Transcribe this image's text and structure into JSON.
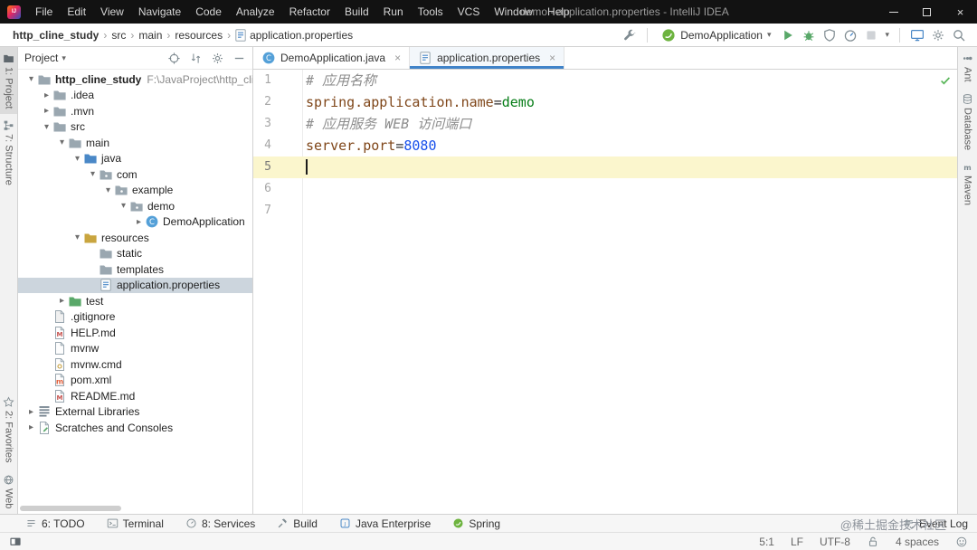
{
  "window": {
    "title": "demo - application.properties - IntelliJ IDEA"
  },
  "menu": [
    "File",
    "Edit",
    "View",
    "Navigate",
    "Code",
    "Analyze",
    "Refactor",
    "Build",
    "Run",
    "Tools",
    "VCS",
    "Window",
    "Help"
  ],
  "toolbar": {
    "breadcrumbs": [
      {
        "label": "http_cline_study",
        "bold": true
      },
      {
        "label": "src"
      },
      {
        "label": "main"
      },
      {
        "label": "resources"
      },
      {
        "label": "application.properties",
        "icon": "properties"
      }
    ],
    "run_config": {
      "label": "DemoApplication",
      "icon": "spring-boot"
    }
  },
  "stripes": {
    "left_top": [
      {
        "label": "1: Project",
        "icon": "project",
        "active": true
      },
      {
        "label": "7: Structure",
        "icon": "structure"
      }
    ],
    "left_bottom": [
      {
        "label": "2: Favorites",
        "icon": "favorites"
      },
      {
        "label": "Web",
        "icon": "web"
      }
    ],
    "right": [
      {
        "label": "Ant",
        "icon": "ant"
      },
      {
        "label": "Database",
        "icon": "database"
      },
      {
        "label": "Maven",
        "icon": "maven"
      }
    ]
  },
  "project": {
    "header": "Project",
    "tree": [
      {
        "label": "http_cline_study",
        "hint": "F:\\JavaProject\\http_cline",
        "level": 0,
        "arrow": "open",
        "icon": "folder",
        "bold": true
      },
      {
        "label": ".idea",
        "level": 1,
        "arrow": "closed",
        "icon": "folder"
      },
      {
        "label": ".mvn",
        "level": 1,
        "arrow": "closed",
        "icon": "folder"
      },
      {
        "label": "src",
        "level": 1,
        "arrow": "open",
        "icon": "folder"
      },
      {
        "label": "main",
        "level": 2,
        "arrow": "open",
        "icon": "folder"
      },
      {
        "label": "java",
        "level": 3,
        "arrow": "open",
        "icon": "folder-src"
      },
      {
        "label": "com",
        "level": 4,
        "arrow": "open",
        "icon": "package"
      },
      {
        "label": "example",
        "level": 5,
        "arrow": "open",
        "icon": "package"
      },
      {
        "label": "demo",
        "level": 6,
        "arrow": "open",
        "icon": "package"
      },
      {
        "label": "DemoApplication",
        "level": 7,
        "arrow": "closed",
        "icon": "class"
      },
      {
        "label": "resources",
        "level": 3,
        "arrow": "open",
        "icon": "folder-res"
      },
      {
        "label": "static",
        "level": 4,
        "icon": "folder"
      },
      {
        "label": "templates",
        "level": 4,
        "icon": "folder"
      },
      {
        "label": "application.properties",
        "level": 4,
        "icon": "properties",
        "selected": true
      },
      {
        "label": "test",
        "level": 2,
        "arrow": "closed",
        "icon": "folder-test"
      },
      {
        "label": ".gitignore",
        "level": 1,
        "icon": "gitignore"
      },
      {
        "label": "HELP.md",
        "level": 1,
        "icon": "md"
      },
      {
        "label": "mvnw",
        "level": 1,
        "icon": "file"
      },
      {
        "label": "mvnw.cmd",
        "level": 1,
        "icon": "cmd"
      },
      {
        "label": "pom.xml",
        "level": 1,
        "icon": "maven-file"
      },
      {
        "label": "README.md",
        "level": 1,
        "icon": "md"
      },
      {
        "label": "External Libraries",
        "level": 0,
        "arrow": "closed",
        "icon": "libraries"
      },
      {
        "label": "Scratches and Consoles",
        "level": 0,
        "arrow": "closed",
        "icon": "scratches"
      }
    ]
  },
  "editor": {
    "tabs": [
      {
        "label": "DemoApplication.java",
        "icon": "class",
        "selected": false
      },
      {
        "label": "application.properties",
        "icon": "properties",
        "selected": true
      }
    ],
    "lines": [
      {
        "num": 1,
        "segments": [
          {
            "text": "# 应用名称",
            "style": "comment"
          }
        ]
      },
      {
        "num": 2,
        "segments": [
          {
            "text": "spring.application.name",
            "style": "key"
          },
          {
            "text": "=",
            "style": "sep"
          },
          {
            "text": "demo",
            "style": "value"
          }
        ]
      },
      {
        "num": 3,
        "segments": [
          {
            "text": "# 应用服务 WEB 访问端口",
            "style": "comment"
          }
        ]
      },
      {
        "num": 4,
        "segments": [
          {
            "text": "server.port",
            "style": "key"
          },
          {
            "text": "=",
            "style": "sep"
          },
          {
            "text": "8080",
            "style": "number"
          }
        ]
      },
      {
        "num": 5,
        "segments": [],
        "current": true
      },
      {
        "num": 6,
        "segments": []
      },
      {
        "num": 7,
        "segments": []
      }
    ],
    "inspection_status": "ok"
  },
  "bottom": {
    "tools": [
      {
        "label": "6: TODO",
        "icon": "todo"
      },
      {
        "label": "Terminal",
        "icon": "terminal"
      },
      {
        "label": "8: Services",
        "icon": "services"
      },
      {
        "label": "Build",
        "icon": "build"
      },
      {
        "label": "Java Enterprise",
        "icon": "javaee"
      },
      {
        "label": "Spring",
        "icon": "spring"
      }
    ],
    "event_log": "Event Log",
    "watermark": "@稀土掘金技术社区"
  },
  "status": {
    "caret": "5:1",
    "line_sep": "LF",
    "encoding": "UTF-8",
    "indent": "4 spaces"
  },
  "colors": {
    "accent_blue": "#4083c9",
    "spring_green": "#6db33f",
    "run_green": "#59a869",
    "caret_line_yellow": "#fbf6cd",
    "selection_gray": "#ccd5dd"
  }
}
